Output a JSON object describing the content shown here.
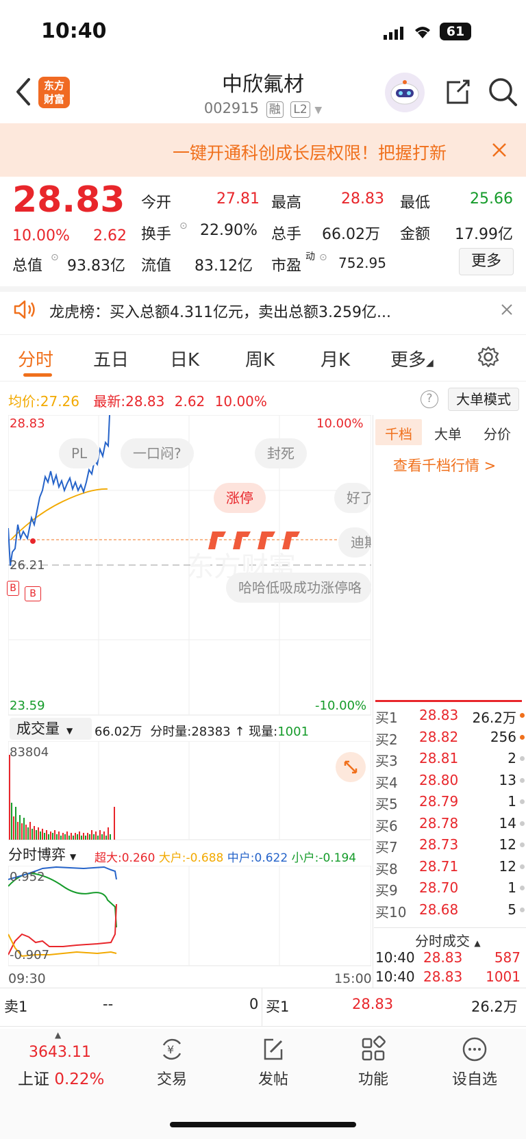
{
  "status_bar": {
    "time": "10:40",
    "battery": "61"
  },
  "header": {
    "logo_text_1": "东方",
    "logo_text_2": "财富",
    "title": "中欣氟材",
    "code": "002915",
    "tag_margin": "融",
    "tag_level": "L2"
  },
  "notice": {
    "text": "一键开通科创成长层权限！把握打新"
  },
  "quote": {
    "price": "28.83",
    "pct": "10.00%",
    "change": "2.62",
    "open_label": "今开",
    "open": "27.81",
    "high_label": "最高",
    "high": "28.83",
    "low_label": "最低",
    "low": "25.66",
    "turnover_label": "换手",
    "turnover": "22.90%",
    "volume_label": "总手",
    "volume": "66.02万",
    "amount_label": "金额",
    "amount": "17.99亿",
    "mktcap_label": "总值",
    "mktcap": "93.83亿",
    "float_label": "流值",
    "float": "83.12亿",
    "pe_label": "市盈",
    "pe_sup": "动",
    "pe": "752.95",
    "more_label": "更多"
  },
  "lhb": {
    "text": "龙虎榜：买入总额4.311亿元，卖出总额3.259亿..."
  },
  "tabs": [
    "分时",
    "五日",
    "日K",
    "周K",
    "月K",
    "更多"
  ],
  "chart_info": {
    "avg_label": "均价:",
    "avg": "27.26",
    "latest_label": "最新:",
    "latest": "28.83",
    "chg": "2.62",
    "pct": "10.00%",
    "mode_label": "大单模式"
  },
  "axis": {
    "top_price": "28.83",
    "top_pct": "10.00%",
    "mid_price": "26.21",
    "bottom_price": "23.59",
    "bottom_pct": "-10.00%",
    "time_start": "09:30",
    "time_end": "15:00"
  },
  "bubbles": [
    "PL",
    "一口闷?",
    "封死",
    "涨停",
    "好了",
    "迪斯",
    "哈哈低吸成功涨停咯"
  ],
  "volume_panel": {
    "selector": "成交量",
    "total": "66.02万",
    "tick_label": "分时量:",
    "tick": "28383",
    "now_label": "现量:",
    "now": "1001",
    "max_label": "83804"
  },
  "game_panel": {
    "selector": "分时博弈",
    "super_label": "超大:",
    "super": "0.260",
    "large_label": "大户:",
    "large": "-0.688",
    "mid_label": "中户:",
    "mid": "0.622",
    "small_label": "小户:",
    "small": "-0.194",
    "top_val": "0.952",
    "bottom_val": "-0.907"
  },
  "right_panel": {
    "tabs": [
      "千档",
      "大单",
      "分价"
    ],
    "link": "查看千档行情 >",
    "buy_orders": [
      {
        "label": "买1",
        "price": "28.83",
        "vol": "26.2万"
      },
      {
        "label": "买2",
        "price": "28.82",
        "vol": "256"
      },
      {
        "label": "买3",
        "price": "28.81",
        "vol": "2"
      },
      {
        "label": "买4",
        "price": "28.80",
        "vol": "13"
      },
      {
        "label": "买5",
        "price": "28.79",
        "vol": "1"
      },
      {
        "label": "买6",
        "price": "28.78",
        "vol": "14"
      },
      {
        "label": "买7",
        "price": "28.73",
        "vol": "12"
      },
      {
        "label": "买8",
        "price": "28.71",
        "vol": "12"
      },
      {
        "label": "买9",
        "price": "28.70",
        "vol": "1"
      },
      {
        "label": "买10",
        "price": "28.68",
        "vol": "5"
      }
    ],
    "trades_title": "分时成交",
    "trades": [
      {
        "time": "10:40",
        "price": "28.83",
        "vol": "587"
      },
      {
        "time": "10:40",
        "price": "28.83",
        "vol": "1001"
      }
    ]
  },
  "level1": {
    "sell_label": "卖1",
    "sell_price": "--",
    "sell_vol": "0",
    "buy_label": "买1",
    "buy_price": "28.83",
    "buy_vol": "26.2万"
  },
  "bottom_nav": {
    "index_value": "3643.11",
    "index_name": "上证",
    "index_pct": "0.22%",
    "items": [
      "交易",
      "发帖",
      "功能",
      "设自选"
    ]
  },
  "colors": {
    "up": "#e8262b",
    "down": "#159b2a",
    "accent": "#f0701c"
  }
}
